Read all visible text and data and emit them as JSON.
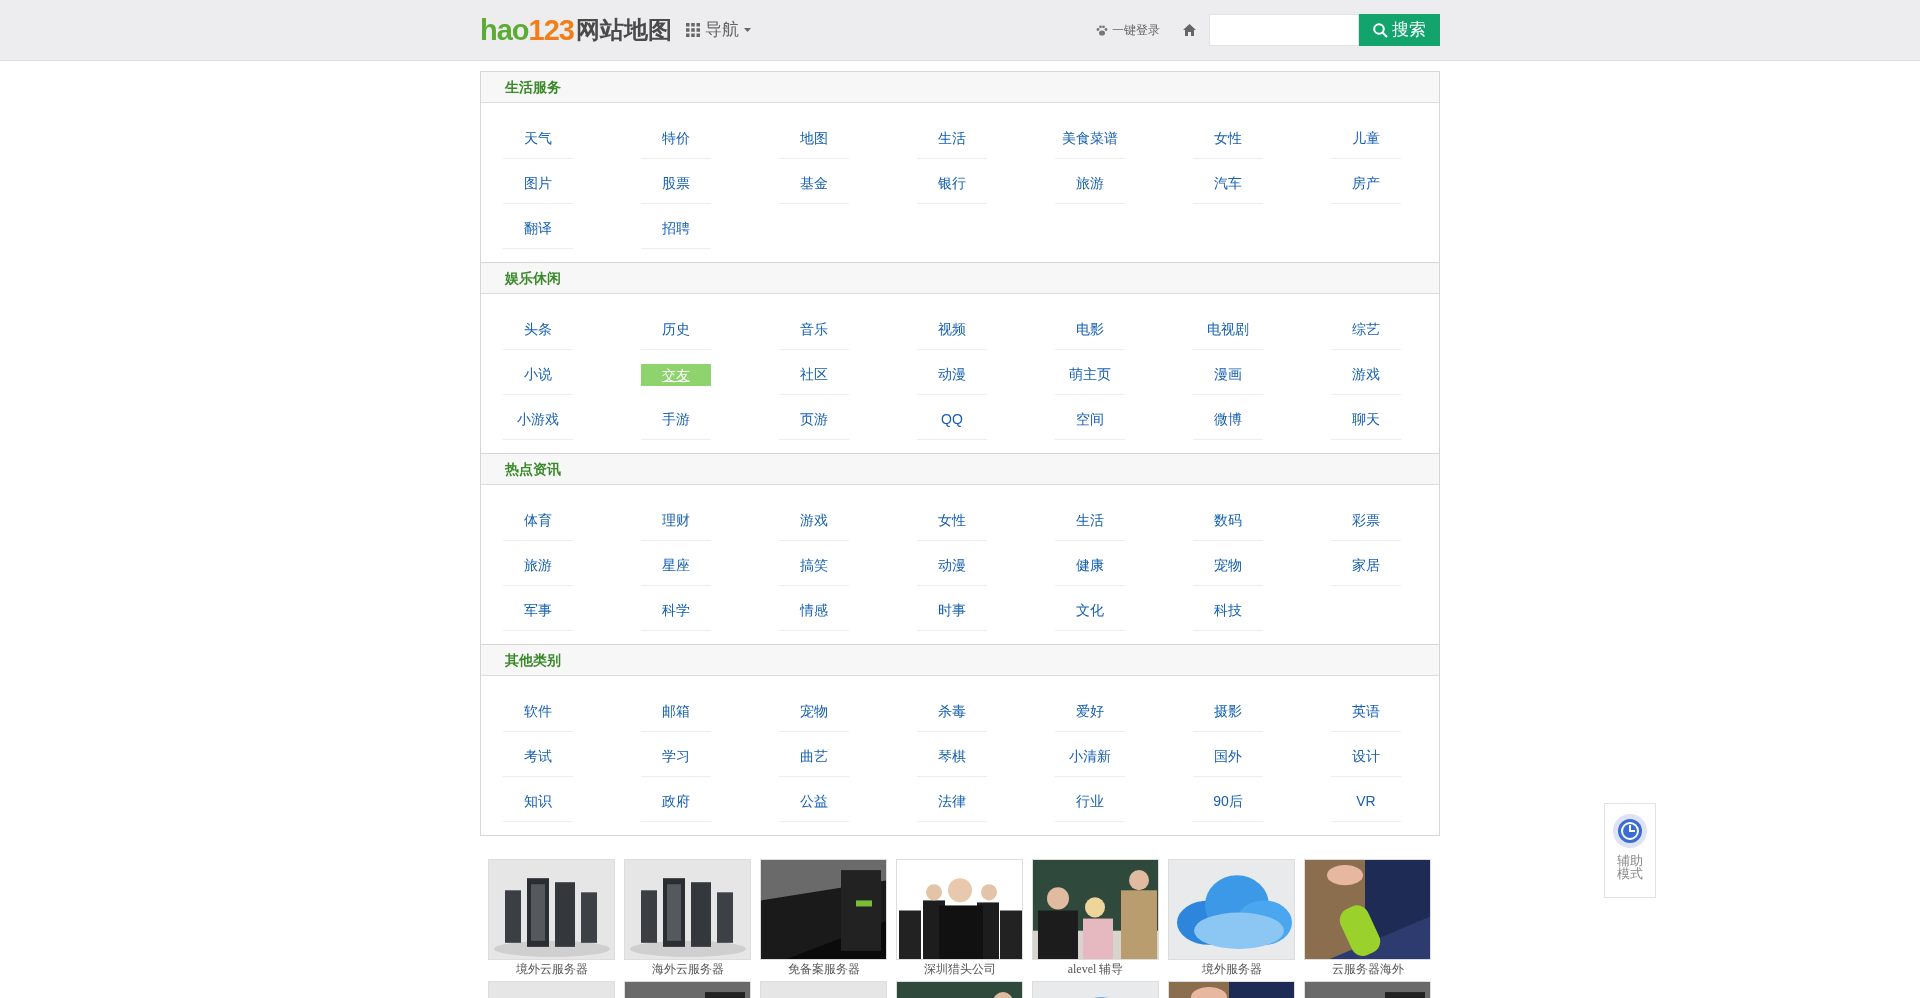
{
  "header": {
    "logo_a": "hao",
    "logo_b": "123",
    "title": "网站地图",
    "nav": "导航",
    "login": "一键登录",
    "search": {
      "button": "搜索"
    }
  },
  "sections": [
    {
      "title": "生活服务",
      "items": [
        {
          "label": "天气",
          "selected": false
        },
        {
          "label": "特价",
          "selected": false
        },
        {
          "label": "地图",
          "selected": false
        },
        {
          "label": "生活",
          "selected": false
        },
        {
          "label": "美食菜谱",
          "selected": false
        },
        {
          "label": "女性",
          "selected": false
        },
        {
          "label": "儿童",
          "selected": false
        },
        {
          "label": "图片",
          "selected": false
        },
        {
          "label": "股票",
          "selected": false
        },
        {
          "label": "基金",
          "selected": false
        },
        {
          "label": "银行",
          "selected": false
        },
        {
          "label": "旅游",
          "selected": false
        },
        {
          "label": "汽车",
          "selected": false
        },
        {
          "label": "房产",
          "selected": false
        },
        {
          "label": "翻译",
          "selected": false
        },
        {
          "label": "招聘",
          "selected": false
        }
      ]
    },
    {
      "title": "娱乐休闲",
      "items": [
        {
          "label": "头条",
          "selected": false
        },
        {
          "label": "历史",
          "selected": false
        },
        {
          "label": "音乐",
          "selected": false
        },
        {
          "label": "视频",
          "selected": false
        },
        {
          "label": "电影",
          "selected": false
        },
        {
          "label": "电视剧",
          "selected": false
        },
        {
          "label": "综艺",
          "selected": false
        },
        {
          "label": "小说",
          "selected": false
        },
        {
          "label": "交友",
          "selected": true
        },
        {
          "label": "社区",
          "selected": false
        },
        {
          "label": "动漫",
          "selected": false
        },
        {
          "label": "萌主页",
          "selected": false
        },
        {
          "label": "漫画",
          "selected": false
        },
        {
          "label": "游戏",
          "selected": false
        },
        {
          "label": "小游戏",
          "selected": false
        },
        {
          "label": "手游",
          "selected": false
        },
        {
          "label": "页游",
          "selected": false
        },
        {
          "label": "QQ",
          "selected": false
        },
        {
          "label": "空间",
          "selected": false
        },
        {
          "label": "微博",
          "selected": false
        },
        {
          "label": "聊天",
          "selected": false
        }
      ]
    },
    {
      "title": "热点资讯",
      "items": [
        {
          "label": "体育",
          "selected": false
        },
        {
          "label": "理财",
          "selected": false
        },
        {
          "label": "游戏",
          "selected": false
        },
        {
          "label": "女性",
          "selected": false
        },
        {
          "label": "生活",
          "selected": false
        },
        {
          "label": "数码",
          "selected": false
        },
        {
          "label": "彩票",
          "selected": false
        },
        {
          "label": "旅游",
          "selected": false
        },
        {
          "label": "星座",
          "selected": false
        },
        {
          "label": "搞笑",
          "selected": false
        },
        {
          "label": "动漫",
          "selected": false
        },
        {
          "label": "健康",
          "selected": false
        },
        {
          "label": "宠物",
          "selected": false
        },
        {
          "label": "家居",
          "selected": false
        },
        {
          "label": "军事",
          "selected": false
        },
        {
          "label": "科学",
          "selected": false
        },
        {
          "label": "情感",
          "selected": false
        },
        {
          "label": "时事",
          "selected": false
        },
        {
          "label": "文化",
          "selected": false
        },
        {
          "label": "科技",
          "selected": false
        }
      ]
    },
    {
      "title": "其他类别",
      "items": [
        {
          "label": "软件",
          "selected": false
        },
        {
          "label": "邮箱",
          "selected": false
        },
        {
          "label": "宠物",
          "selected": false
        },
        {
          "label": "杀毒",
          "selected": false
        },
        {
          "label": "爱好",
          "selected": false
        },
        {
          "label": "摄影",
          "selected": false
        },
        {
          "label": "英语",
          "selected": false
        },
        {
          "label": "考试",
          "selected": false
        },
        {
          "label": "学习",
          "selected": false
        },
        {
          "label": "曲艺",
          "selected": false
        },
        {
          "label": "琴棋",
          "selected": false
        },
        {
          "label": "小清新",
          "selected": false
        },
        {
          "label": "国外",
          "selected": false
        },
        {
          "label": "设计",
          "selected": false
        },
        {
          "label": "知识",
          "selected": false
        },
        {
          "label": "政府",
          "selected": false
        },
        {
          "label": "公益",
          "selected": false
        },
        {
          "label": "法律",
          "selected": false
        },
        {
          "label": "行业",
          "selected": false
        },
        {
          "label": "90后",
          "selected": false
        },
        {
          "label": "VR",
          "selected": false
        }
      ]
    }
  ],
  "ads": [
    {
      "caption": "境外云服务器"
    },
    {
      "caption": "海外云服务器"
    },
    {
      "caption": "免备案服务器"
    },
    {
      "caption": "深圳猎头公司"
    },
    {
      "caption": "alevel 辅导"
    },
    {
      "caption": "境外服务器"
    },
    {
      "caption": "云服务器海外"
    }
  ],
  "side_widget": {
    "label": "辅助模式"
  }
}
